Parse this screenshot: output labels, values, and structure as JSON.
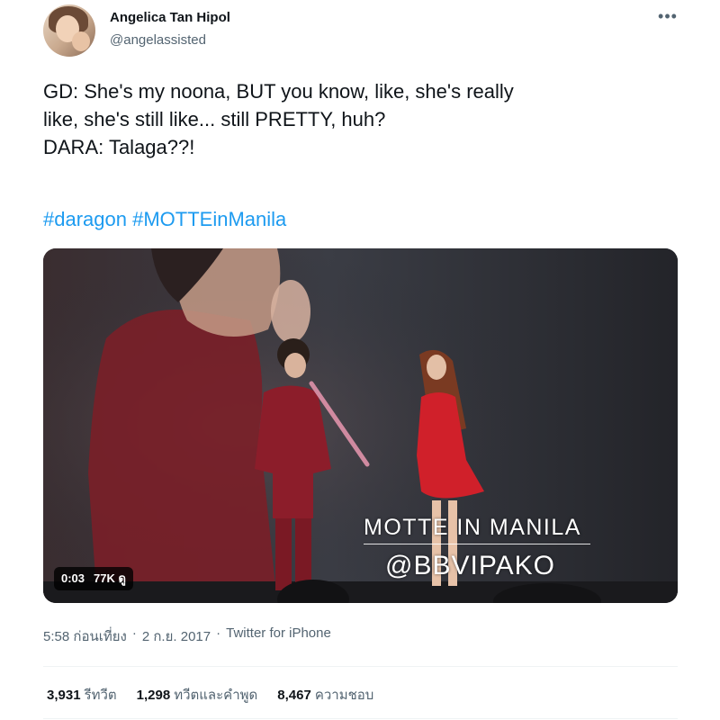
{
  "author": {
    "name": "Angelica Tan Hipol",
    "handle": "@angelassisted"
  },
  "tweet": {
    "text": "GD: She's my noona, BUT you know, like, she's really\nlike, she's still like... still PRETTY, huh?\nDARA: Talaga??!",
    "hashtags": [
      "#daragon",
      "#MOTTEinManila"
    ]
  },
  "video": {
    "overlay_line1": "MOTTE IN MANILA",
    "overlay_line2": "@BBVIPAKO",
    "duration": "0:03",
    "views": "77K ดู"
  },
  "meta": {
    "time": "5:58 ก่อนเที่ยง",
    "separator": "·",
    "date": "2 ก.ย. 2017",
    "source": "Twitter for iPhone"
  },
  "stats": {
    "retweets": {
      "value": "3,931",
      "label": "รีทวีต"
    },
    "quotes": {
      "value": "1,298",
      "label": "ทวีตและคำพูด"
    },
    "likes": {
      "value": "8,467",
      "label": "ความชอบ"
    }
  },
  "icons": {
    "more": "more-horizontal-icon"
  },
  "colors": {
    "link": "#1d9bf0",
    "secondary_text": "#536471"
  }
}
